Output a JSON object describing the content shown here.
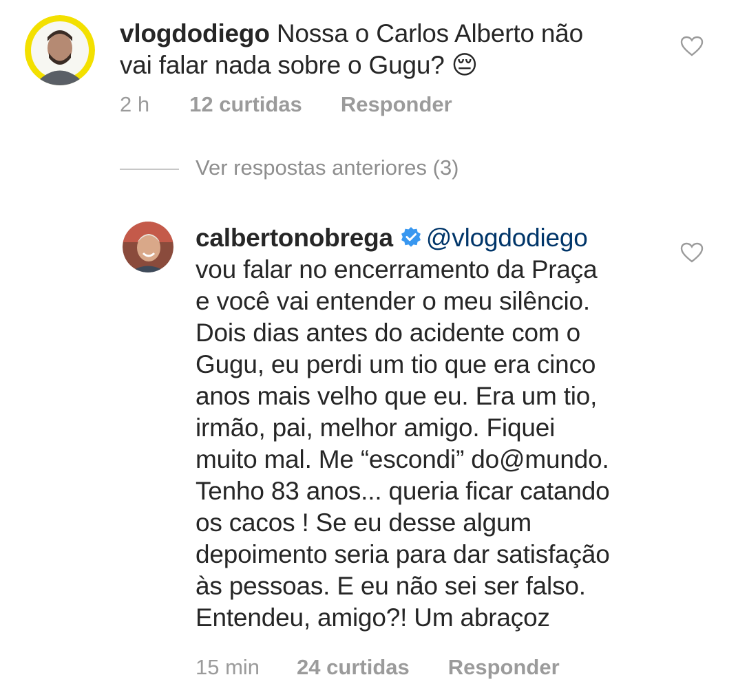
{
  "comment1": {
    "username": "vlogdodiego",
    "text_line1": "Nossa o Carlos Alberto não",
    "text_line2": "vai falar nada sobre o Gugu? 😔",
    "time": "2 h",
    "likes": "12 curtidas",
    "reply_label": "Responder"
  },
  "view_replies_label": "Ver respostas anteriores (3)",
  "comment2": {
    "username": "calbertonobrega",
    "mention": "@vlogdodiego",
    "lines": [
      "vou falar no encerramento da Praça",
      "e você vai entender o meu silêncio.",
      "Dois dias antes do acidente com o",
      "Gugu, eu perdi um tio que era cinco",
      "anos mais velho que eu. Era um tio,",
      "irmão, pai, melhor amigo. Fiquei",
      "muito mal. Me “escondi” do@mundo.",
      "Tenho 83 anos... queria ficar catando",
      "os cacos ! Se eu desse algum",
      "depoimento seria para dar satisfação",
      "às pessoas.  E eu não sei ser falso.",
      "Entendeu, amigo?! Um abraçoz"
    ],
    "time": "15 min",
    "likes": "24 curtidas",
    "reply_label": "Responder"
  },
  "icons": {
    "like": "heart-outline-icon",
    "verified": "verified-badge-icon"
  },
  "colors": {
    "text": "#262626",
    "meta": "#9b9b9b",
    "verified": "#3897f0",
    "avatar_ring": "#f5e400"
  }
}
